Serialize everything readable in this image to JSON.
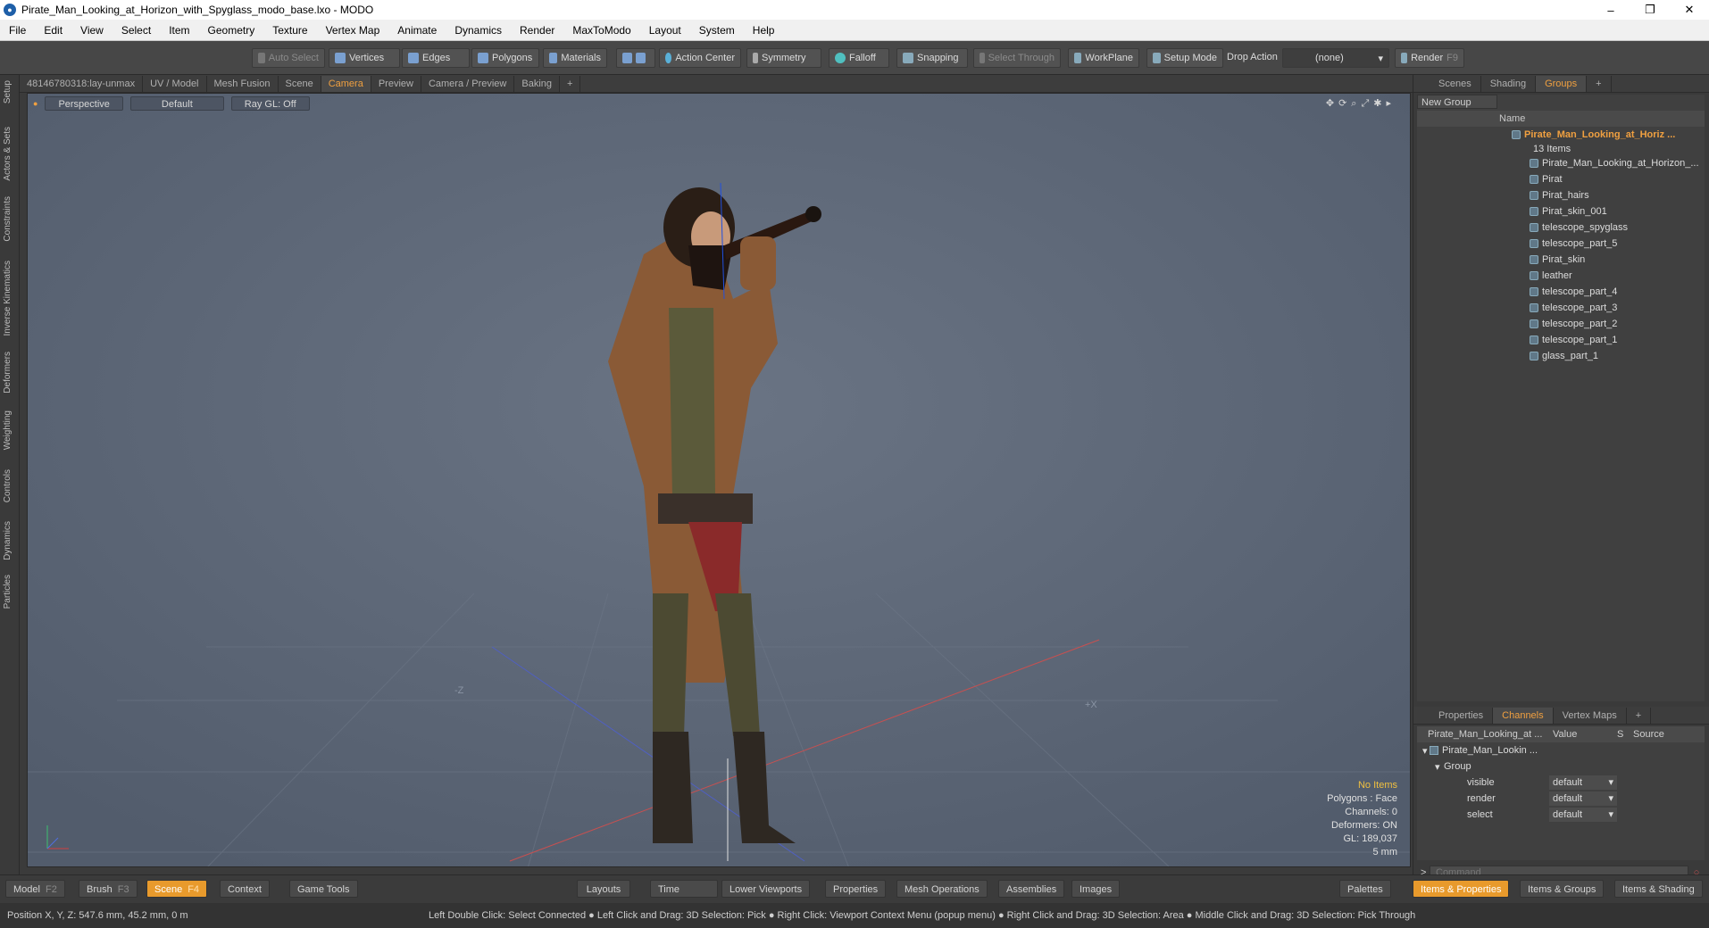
{
  "window": {
    "title": "Pirate_Man_Looking_at_Horizon_with_Spyglass_modo_base.lxo - MODO",
    "min": "–",
    "max": "❐",
    "close": "✕"
  },
  "menu": [
    "File",
    "Edit",
    "View",
    "Select",
    "Item",
    "Geometry",
    "Texture",
    "Vertex Map",
    "Animate",
    "Dynamics",
    "Render",
    "MaxToModo",
    "Layout",
    "System",
    "Help"
  ],
  "toolbar": {
    "auto_select": "Auto Select",
    "vertices": "Vertices",
    "edges": "Edges",
    "polygons": "Polygons",
    "materials": "Materials",
    "action_center": "Action Center",
    "symmetry": "Symmetry",
    "falloff": "Falloff",
    "snapping": "Snapping",
    "select_through": "Select Through",
    "workplane": "WorkPlane",
    "setup_mode": "Setup Mode",
    "drop_action": "Drop Action",
    "drop_value": "(none)",
    "render": "Render",
    "render_key": "F9"
  },
  "left_tabs": [
    "Setup",
    "Actors & Sets",
    "Constraints",
    "Inverse Kinematics",
    "Deformers",
    "Weighting",
    "Controls",
    "Dynamics",
    "Particles"
  ],
  "viewport_tabs": [
    "48146780318:lay-unmax",
    "UV / Model",
    "Mesh Fusion",
    "Scene",
    "Camera",
    "Preview",
    "Camera / Preview",
    "Baking",
    "+"
  ],
  "viewport": {
    "perspective": "Perspective",
    "default": "Default",
    "raygl": "Ray GL: Off",
    "stats": {
      "no_items": "No Items",
      "polygons": "Polygons : Face",
      "channels": "Channels: 0",
      "deformers": "Deformers: ON",
      "gl": "GL: 189,037",
      "scale": "5 mm"
    },
    "axis_minus_z": "-Z",
    "axis_plus_x": "+X"
  },
  "right_tabs": [
    "Scenes",
    "Shading",
    "Groups",
    "+"
  ],
  "groups": {
    "new_group": "New Group",
    "name_col": "Name",
    "title": "Pirate_Man_Looking_at_Horiz ...",
    "count": "13 Items",
    "items": [
      "Pirate_Man_Looking_at_Horizon_...",
      "Pirat",
      "Pirat_hairs",
      "Pirat_skin_001",
      "telescope_spyglass",
      "telescope_part_5",
      "Pirat_skin",
      "leather",
      "telescope_part_4",
      "telescope_part_3",
      "telescope_part_2",
      "telescope_part_1",
      "glass_part_1"
    ]
  },
  "prop_tabs": [
    "Properties",
    "Channels",
    "Vertex Maps",
    "+"
  ],
  "channels": {
    "col1": "Pirate_Man_Looking_at ...",
    "col2": "Value",
    "col3": "S",
    "col4": "Source",
    "root": "Pirate_Man_Lookin ...",
    "group": "Group",
    "rows": [
      {
        "name": "visible",
        "value": "default"
      },
      {
        "name": "render",
        "value": "default"
      },
      {
        "name": "select",
        "value": "default"
      }
    ]
  },
  "command": {
    "prompt": ">",
    "placeholder": "Command"
  },
  "bottom": {
    "model": "Model",
    "model_key": "F2",
    "brush": "Brush",
    "brush_key": "F3",
    "scene": "Scene",
    "scene_key": "F4",
    "context": "Context",
    "game_tools": "Game Tools",
    "layouts": "Layouts",
    "time": "Time",
    "lower_viewports": "Lower Viewports",
    "properties": "Properties",
    "mesh_operations": "Mesh Operations",
    "assemblies": "Assemblies",
    "images": "Images",
    "palettes": "Palettes",
    "items_properties": "Items & Properties",
    "items_groups": "Items & Groups",
    "items_shading": "Items & Shading"
  },
  "status": {
    "position": "Position X, Y, Z:   547.6 mm, 45.2 mm, 0 m",
    "hint": "Left Double Click: Select Connected ● Left Click and Drag: 3D Selection: Pick ● Right Click: Viewport Context Menu (popup menu) ● Right Click and Drag: 3D Selection: Area ● Middle Click and Drag: 3D Selection: Pick Through"
  },
  "colors": {
    "accent": "#f0a040",
    "viewport_bg": "#5c6676"
  }
}
